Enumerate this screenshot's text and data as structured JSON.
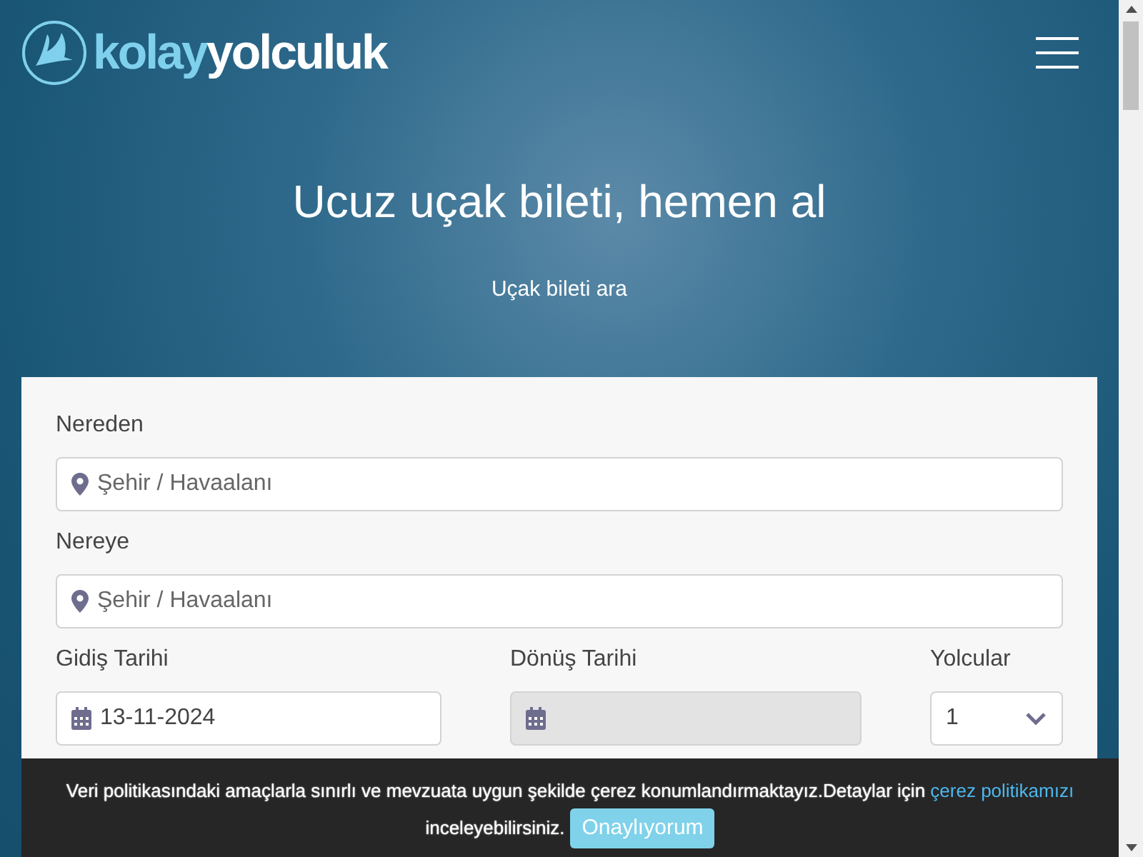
{
  "header": {
    "logo": {
      "part_1": "kolay",
      "part_2": "yolculuk"
    }
  },
  "hero": {
    "title": "Ucuz uçak bileti, hemen al",
    "subtitle": "Uçak bileti ara"
  },
  "search_form": {
    "from": {
      "label": "Nereden",
      "placeholder": "Şehir / Havaalanı"
    },
    "to": {
      "label": "Nereye",
      "placeholder": "Şehir / Havaalanı"
    },
    "departure": {
      "label": "Gidiş Tarihi",
      "value": "13-11-2024",
      "disabled": false
    },
    "return": {
      "label": "Dönüş Tarihi",
      "disabled": true
    },
    "passengers": {
      "label": "Yolcular",
      "value": "1"
    }
  },
  "cookie_banner": {
    "text": "Veri politikasındaki amaçlarla sınırlı ve mevzuata uygun şekilde çerez konumlandırmaktayız.Detaylar için",
    "link": "çerez politikamızı",
    "text_after": "inceleyebilirsiniz.",
    "button": "Onaylıyorum"
  }
}
